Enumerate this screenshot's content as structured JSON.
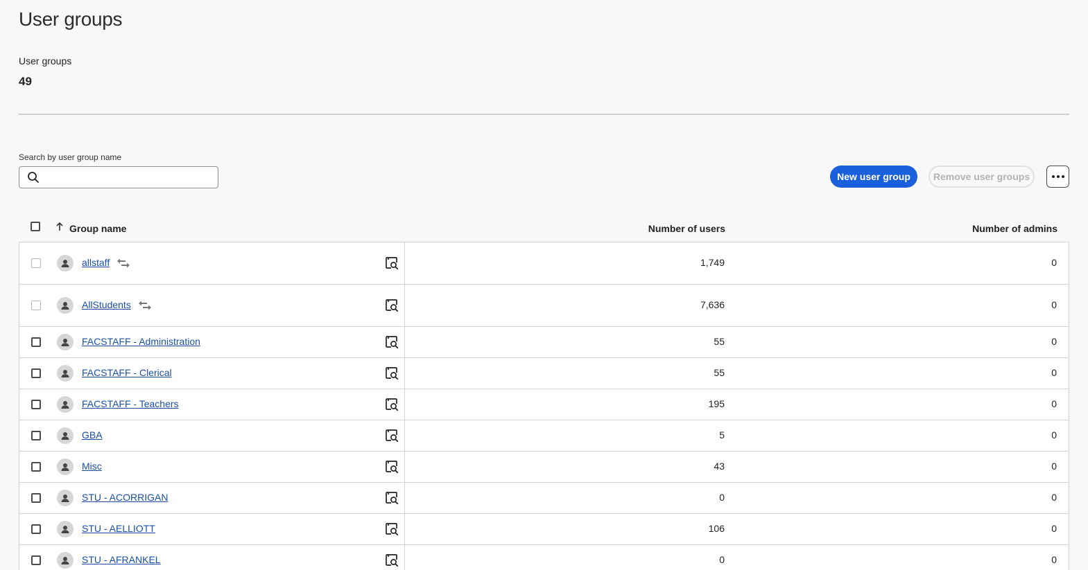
{
  "page": {
    "title": "User groups"
  },
  "stats": {
    "label": "User groups",
    "value": "49"
  },
  "search": {
    "label": "Search by user group name",
    "placeholder": "",
    "value": ""
  },
  "toolbar": {
    "new_label": "New user group",
    "remove_label": "Remove user groups",
    "more_icon": "ellipsis-icon"
  },
  "colors": {
    "accent": "#1a5fdc",
    "link": "#1a4fa8"
  },
  "table": {
    "columns": [
      "Group name",
      "Number of users",
      "Number of admins"
    ],
    "sort": {
      "column": "Group name",
      "direction": "ascending"
    },
    "rows": [
      {
        "name": "allstaff",
        "users": "1,749",
        "admins": "0",
        "synced": true
      },
      {
        "name": "AllStudents",
        "users": "7,636",
        "admins": "0",
        "synced": true
      },
      {
        "name": "FACSTAFF - Administration",
        "users": "55",
        "admins": "0",
        "synced": false
      },
      {
        "name": "FACSTAFF - Clerical",
        "users": "55",
        "admins": "0",
        "synced": false
      },
      {
        "name": "FACSTAFF - Teachers",
        "users": "195",
        "admins": "0",
        "synced": false
      },
      {
        "name": "GBA",
        "users": "5",
        "admins": "0",
        "synced": false
      },
      {
        "name": "Misc",
        "users": "43",
        "admins": "0",
        "synced": false
      },
      {
        "name": "STU - ACORRIGAN",
        "users": "0",
        "admins": "0",
        "synced": false
      },
      {
        "name": "STU - AELLIOTT",
        "users": "106",
        "admins": "0",
        "synced": false
      },
      {
        "name": "STU - AFRANKEL",
        "users": "0",
        "admins": "0",
        "synced": false
      }
    ]
  }
}
